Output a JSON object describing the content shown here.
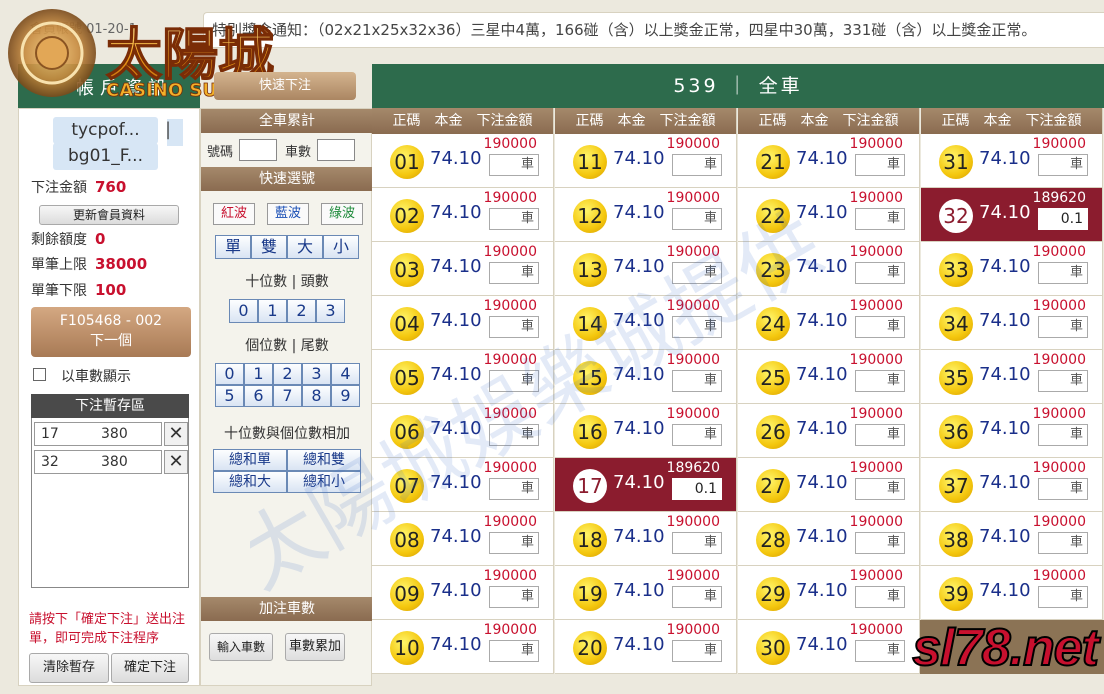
{
  "top": {
    "user_info": "會員帳號 01-20-1",
    "ticker": "特別獎金通知：（02x21x25x32x36）三星中4萬，166碰（含）以上獎金正常，四星中30萬，331碰（含）以上獎金正常。",
    "logo_text": "太陽城",
    "logo_sub": "CASINO SUNCITY"
  },
  "left": {
    "header": "帳戶資訊",
    "username1": "tycpof...",
    "separator": "|",
    "username2": "bg01_F...",
    "bet_amount_label": "下注金額",
    "bet_amount": "760",
    "update_btn": "更新會員資料",
    "remaining_label": "剩餘額度",
    "remaining": "0",
    "max_label": "單筆上限",
    "max": "38000",
    "min_label": "單筆下限",
    "min": "100",
    "next_line1": "F105468 - 002",
    "next_line2": "下一個",
    "show_by_car": "以車數顯示",
    "stash_title": "下注暫存區",
    "stash": [
      {
        "num": "17",
        "amt": "380"
      },
      {
        "num": "32",
        "amt": "380"
      }
    ],
    "note": "請按下「確定下注」送出注單，即可完成下注程序",
    "clear_btn": "清除暫存",
    "confirm_btn": "確定下注"
  },
  "middle": {
    "speed_btn": "快速下注",
    "full_car_title": "全車累計",
    "code_label": "號碼",
    "car_label": "車數",
    "quick_title": "快速選號",
    "waves": [
      "紅波",
      "藍波",
      "綠波"
    ],
    "dsbs": [
      "單",
      "雙",
      "大",
      "小"
    ],
    "tens_title": "十位數 | 頭數",
    "tens": [
      "0",
      "1",
      "2",
      "3"
    ],
    "units_title": "個位數 | 尾數",
    "units_row1": [
      "0",
      "1",
      "2",
      "3",
      "4"
    ],
    "units_row2": [
      "5",
      "6",
      "7",
      "8",
      "9"
    ],
    "sum_title": "十位數與個位數相加",
    "sum_btns": [
      "總和單",
      "總和雙",
      "總和大",
      "總和小"
    ],
    "add_title": "加注車數",
    "input_car_btn": "輸入車數",
    "add_car_btn": "車數累加"
  },
  "grid": {
    "title": "539 ｜ 全車",
    "col_header": "正碼　本金　下注金額",
    "odds": "74.10",
    "limit_default": "190000",
    "placeholder": "車",
    "selected": {
      "17": {
        "limit": "189620",
        "value": "0.1"
      },
      "32": {
        "limit": "189620",
        "value": "0.1"
      }
    },
    "colors": {
      "header_green": "#2d6b4c",
      "selected_red": "#8b1c2e"
    }
  },
  "watermark": {
    "text": "太陽城娛樂城提供",
    "site": "sl78.net"
  }
}
